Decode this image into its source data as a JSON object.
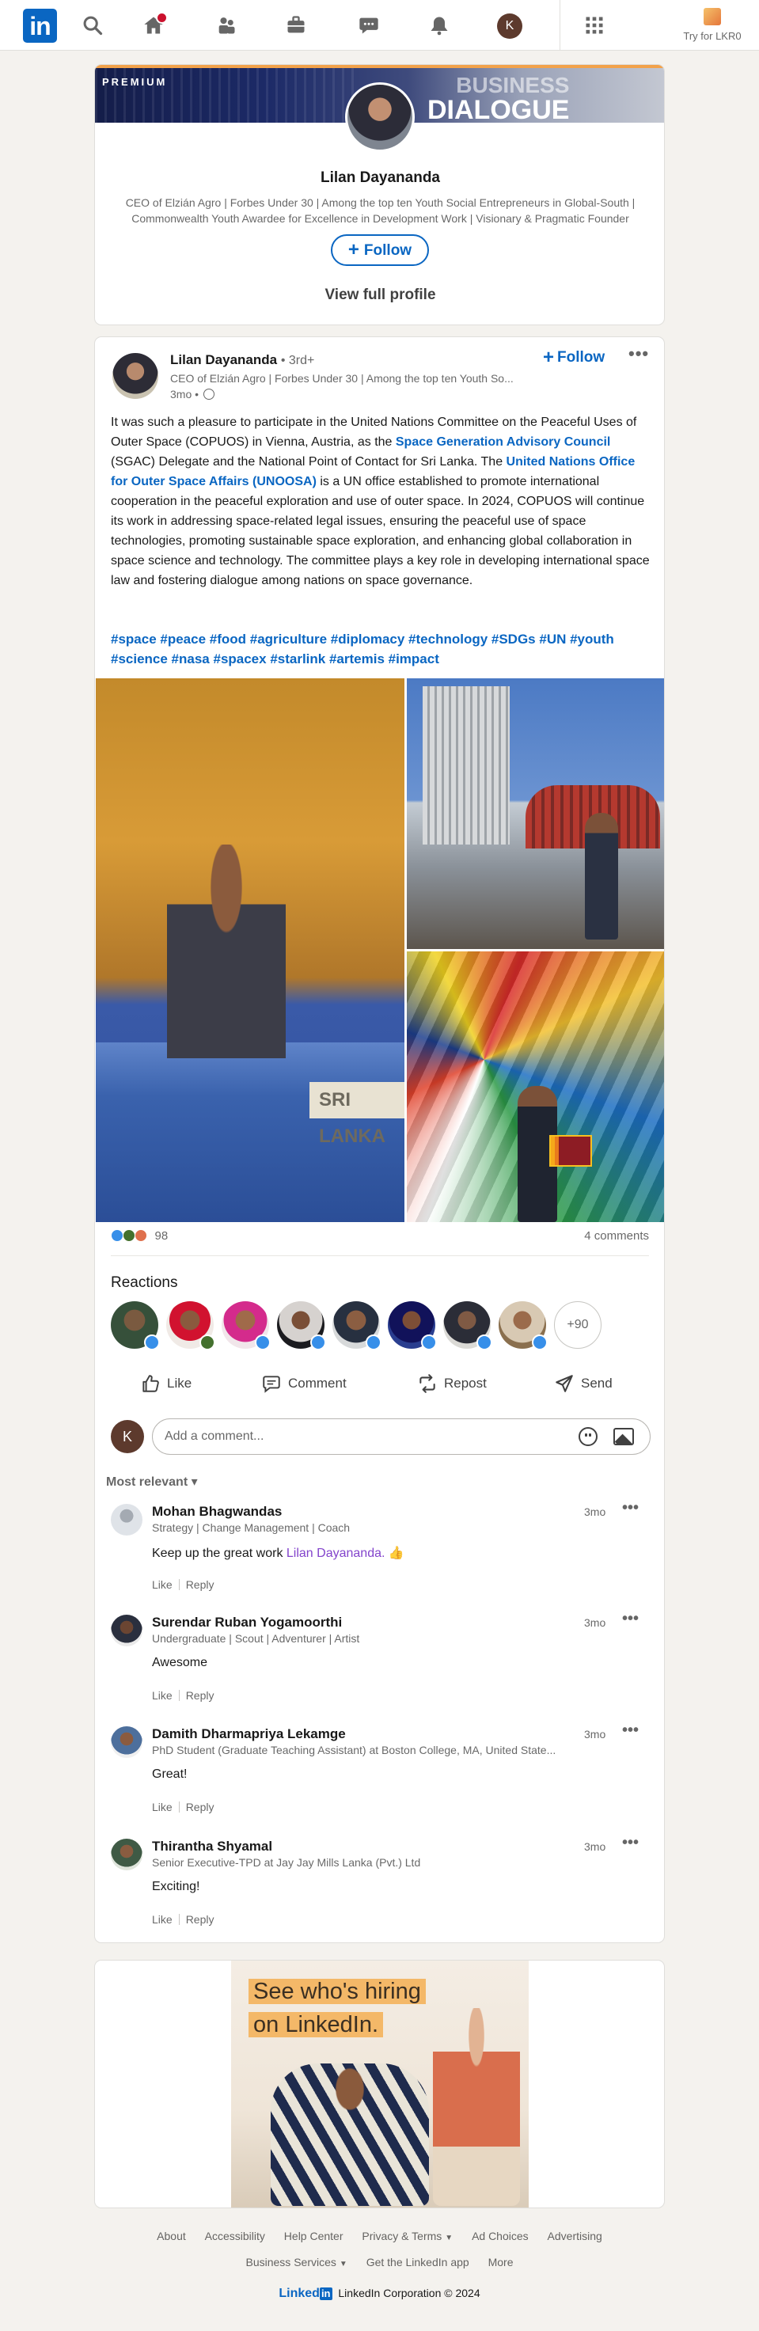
{
  "nav": {
    "logo_text": "in",
    "avatar_initial": "K",
    "try_label": "Try for LKR0"
  },
  "profile_card": {
    "banner_label": "PREMIUM",
    "banner_text_1": "BUSINESS",
    "banner_text_2": "DIALOGUE",
    "name": "Lilan Dayananda",
    "headline": "CEO of Elzián Agro | Forbes Under 30 | Among the top ten Youth Social Entrepreneurs in Global-South | Commonwealth Youth Awardee for Excellence in Development Work | Visionary & Pragmatic Founder",
    "follow_label": "Follow",
    "view_profile_label": "View full profile"
  },
  "post": {
    "author": "Lilan Dayananda",
    "degree": "• 3rd+",
    "headline": "CEO of Elzián Agro | Forbes Under 30 | Among the top ten Youth So...",
    "time": "3mo •",
    "follow_label": "Follow",
    "more_label": "•••",
    "body_1": "It was such a pleasure to participate in the United Nations Committee on the Peaceful Uses of Outer Space (COPUOS) in Vienna, Austria, as the ",
    "link_1": "Space Generation Advisory Council",
    "body_2": " (SGAC) Delegate and the National Point of Contact for Sri Lanka. The ",
    "link_2": "United Nations Office for Outer Space Affairs (UNOOSA)",
    "body_3": " is a UN office established to promote international cooperation in the peaceful exploration and use of outer space. In 2024, COPUOS will continue its work in addressing space-related legal issues, ensuring the peaceful use of space technologies, promoting sustainable space exploration, and enhancing global collaboration in space science and technology. The committee plays a key role in developing international space law and fostering dialogue among nations on space governance.",
    "hashtags": "#space #peace #food #agriculture #diplomacy #technology #SDGs #UN #youth #science #nasa #spacex #starlink #artemis #impact",
    "photo_plaque": "SRI LANKA",
    "reaction_count": "98",
    "comments_count": "4 comments",
    "reactions_title": "Reactions",
    "more_reactors": "+90",
    "actions": {
      "like": "Like",
      "comment": "Comment",
      "repost": "Repost",
      "send": "Send"
    },
    "comment_placeholder": "Add a comment...",
    "sort_label": "Most relevant",
    "comments": [
      {
        "name": "Mohan Bhagwandas",
        "headline": "Strategy | Change Management | Coach",
        "time": "3mo",
        "text": "Keep up the great work ",
        "mention": "Lilan Dayananda.",
        "emoji": " 👍",
        "like": "Like",
        "reply": "Reply"
      },
      {
        "name": "Surendar Ruban Yogamoorthi",
        "headline": "Undergraduate | Scout | Adventurer | Artist",
        "time": "3mo",
        "text": "Awesome",
        "like": "Like",
        "reply": "Reply"
      },
      {
        "name": "Damith Dharmapriya Lekamge",
        "headline": "PhD Student (Graduate Teaching Assistant) at Boston College, MA, United State...",
        "time": "3mo",
        "text": "Great!",
        "like": "Like",
        "reply": "Reply"
      },
      {
        "name": "Thirantha Shyamal",
        "headline": "Senior Executive-TPD at Jay Jay Mills Lanka (Pvt.) Ltd",
        "time": "3mo",
        "text": "Exciting!",
        "like": "Like",
        "reply": "Reply"
      }
    ]
  },
  "ad": {
    "headline_1": "See who's hiring",
    "headline_2": "on LinkedIn."
  },
  "footer": {
    "links_row1": [
      "About",
      "Accessibility",
      "Help Center",
      "Privacy & Terms",
      "Ad Choices",
      "Advertising"
    ],
    "links_row2": [
      "Business Services",
      "Get the LinkedIn app",
      "More"
    ],
    "brand_text": "Linked",
    "brand_box": "in",
    "copyright": "LinkedIn Corporation © 2024"
  },
  "colors": {
    "brand_blue": "#0a66c2",
    "page_bg": "#f4f2ee",
    "mention_purple": "#8344cc"
  }
}
